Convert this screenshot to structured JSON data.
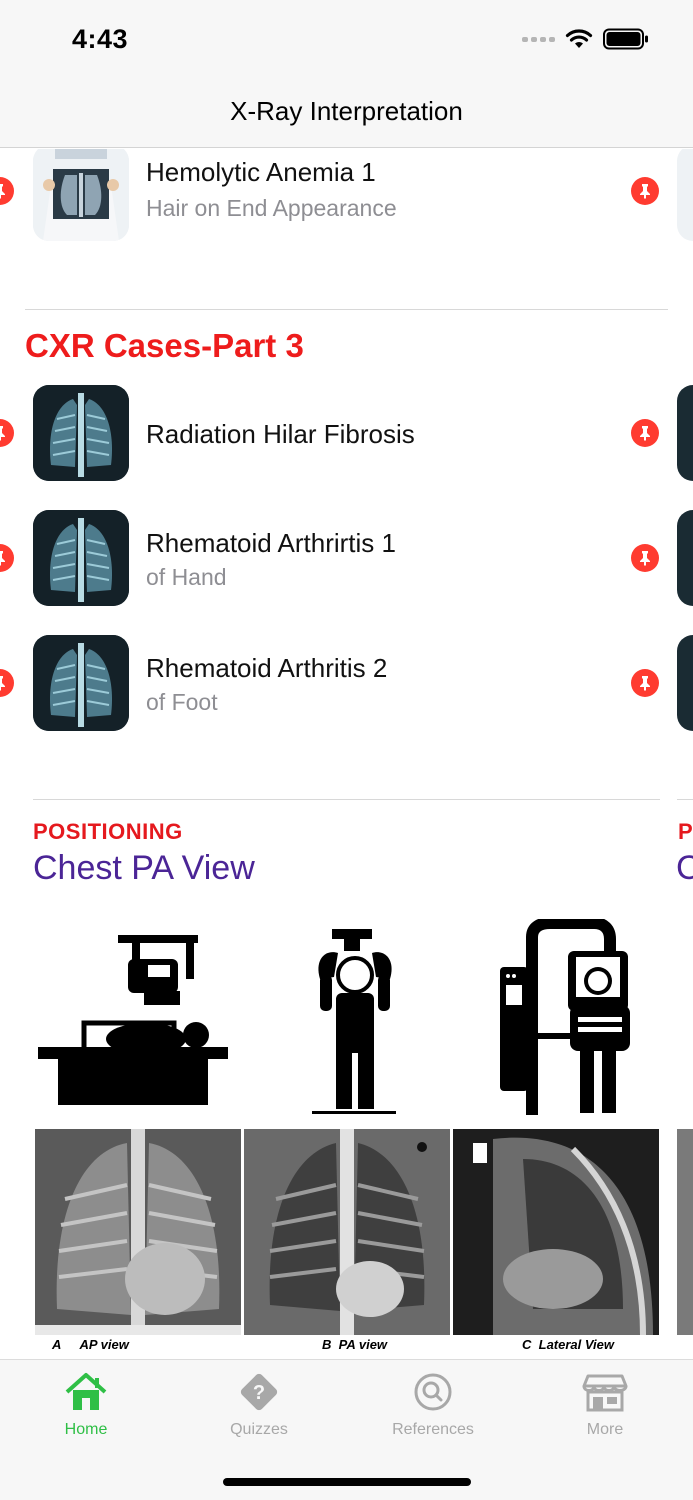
{
  "status_bar": {
    "time": "4:43",
    "icons": [
      "signal-icon",
      "wifi-icon",
      "battery-icon"
    ]
  },
  "nav": {
    "title": "X-Ray Interpretation"
  },
  "top_item": {
    "title": "Hemolytic Anemia 1",
    "subtitle": "Hair on End Appearance",
    "thumb": "doctor-holding-xray"
  },
  "section": {
    "title": "CXR Cases-Part 3",
    "items": [
      {
        "title": "Radiation Hilar Fibrosis",
        "subtitle": ""
      },
      {
        "title": "Rhematoid Arthrirtis 1",
        "subtitle": "of Hand"
      },
      {
        "title": "Rhematoid Arthritis 2",
        "subtitle": "of Foot"
      }
    ]
  },
  "positioning": {
    "label": "POSITIONING",
    "title": "Chest PA View",
    "peek_label": "P",
    "peek_title": "C",
    "illustrations": [
      "patient-supine-xray-icon",
      "standing-patient-xray-icon",
      "erect-chest-stand-xray-icon"
    ],
    "views": [
      {
        "letter": "A",
        "caption": "AP view"
      },
      {
        "letter": "B",
        "caption": "PA view"
      },
      {
        "letter": "C",
        "caption": "Lateral View"
      }
    ]
  },
  "tabs": [
    {
      "label": "Home",
      "icon": "home-icon",
      "active": true
    },
    {
      "label": "Quizzes",
      "icon": "quiz-diamond-icon",
      "active": false
    },
    {
      "label": "References",
      "icon": "search-icon",
      "active": false
    },
    {
      "label": "More",
      "icon": "store-icon",
      "active": false
    }
  ],
  "colors": {
    "accent_red": "#ee1c1c",
    "pin_red": "#ff3b30",
    "title_purple": "#4b2596",
    "tab_active": "#2fbf46",
    "tab_inactive": "#a8a8a8"
  }
}
